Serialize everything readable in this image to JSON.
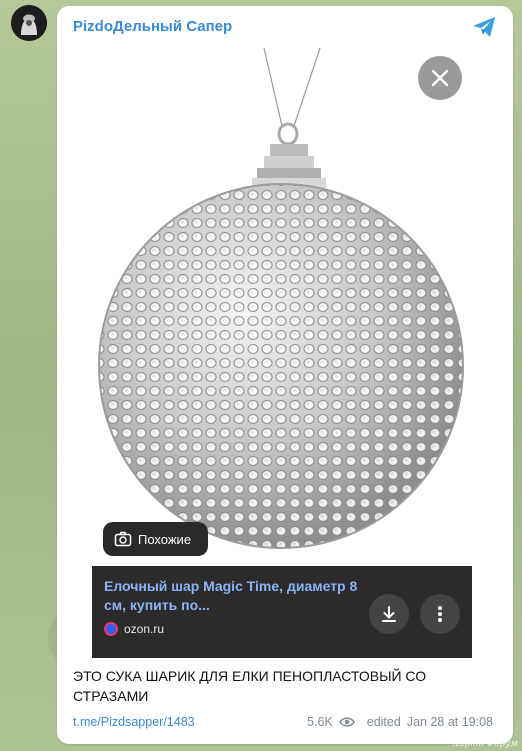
{
  "channel": {
    "name": "PizdoДельный Сапер"
  },
  "media": {
    "similar_label": "Похожие",
    "result": {
      "title": "Елочный шар Magic Time, диаметр 8 см, купить по...",
      "source": "ozon.ru"
    }
  },
  "post": {
    "caption": "ЭТО СУКА ШАРИК ДЛЯ ЕЛКИ ПЕНОПЛАСТОВЫЙ СО СТРАЗАМИ",
    "link": "t.me/Pizdsapper/1483",
    "views": "5.6K",
    "edited": "edited",
    "date": "Jan 28 at 19:08"
  },
  "watermark": "Харків Форум",
  "colors": {
    "accent": "#3a8bd2",
    "link_blue": "#8ab4f8",
    "card_bg": "#2b2b2b"
  }
}
